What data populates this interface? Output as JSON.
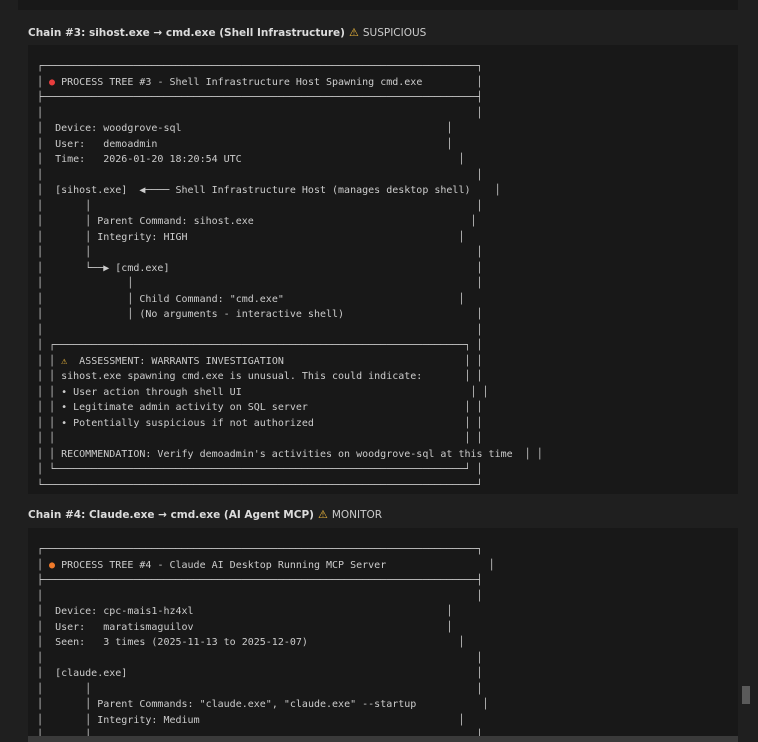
{
  "chain3": {
    "title": "Chain #3: sihost.exe → cmd.exe (Shell Infrastructure)",
    "warn_icon": "⚠",
    "status": "SUSPICIOUS",
    "tree_title": "PROCESS TREE #3 - Shell Infrastructure Host Spawning cmd.exe",
    "device_label": "Device:",
    "device": "woodgrove-sql",
    "user_label": "User:",
    "user": "demoadmin",
    "time_label": "Time:",
    "time": "2026-01-20 18:20:54 UTC",
    "parent_proc": "[sihost.exe]",
    "parent_note": "Shell Infrastructure Host (manages desktop shell)",
    "parent_cmd_label": "Parent Command:",
    "parent_cmd": "sihost.exe",
    "integrity_label": "Integrity:",
    "integrity": "HIGH",
    "child_proc": "[cmd.exe]",
    "child_cmd_label": "Child Command:",
    "child_cmd": "\"cmd.exe\"",
    "child_note": "(No arguments - interactive shell)",
    "assessment": "ASSESSMENT: WARRANTS INVESTIGATION",
    "assessment_line1": "sihost.exe spawning cmd.exe is unusual. This could indicate:",
    "bullet1": "• User action through shell UI",
    "bullet2": "• Legitimate admin activity on SQL server",
    "bullet3": "• Potentially suspicious if not authorized",
    "recommendation": "RECOMMENDATION: Verify demoadmin's activities on woodgrove-sql at this time"
  },
  "chain4": {
    "title": "Chain #4: Claude.exe → cmd.exe (AI Agent MCP)",
    "warn_icon": "⚠",
    "status": "MONITOR",
    "tree_title": "PROCESS TREE #4 - Claude AI Desktop Running MCP Server",
    "device_label": "Device:",
    "device": "cpc-mais1-hz4xl",
    "user_label": "User:",
    "user": "maratismaguilov",
    "seen_label": "Seen:",
    "seen": "3 times (2025-11-13 to 2025-12-07)",
    "parent_proc": "[claude.exe]",
    "parent_cmd_label": "Parent Commands:",
    "parent_cmd": "\"claude.exe\", \"claude.exe\" --startup",
    "integrity_label": "Integrity:",
    "integrity": "Medium"
  },
  "colors": {
    "red_dot": "#e83d3d",
    "orange_dot": "#f07a2a",
    "warning": "#f0b93c"
  }
}
